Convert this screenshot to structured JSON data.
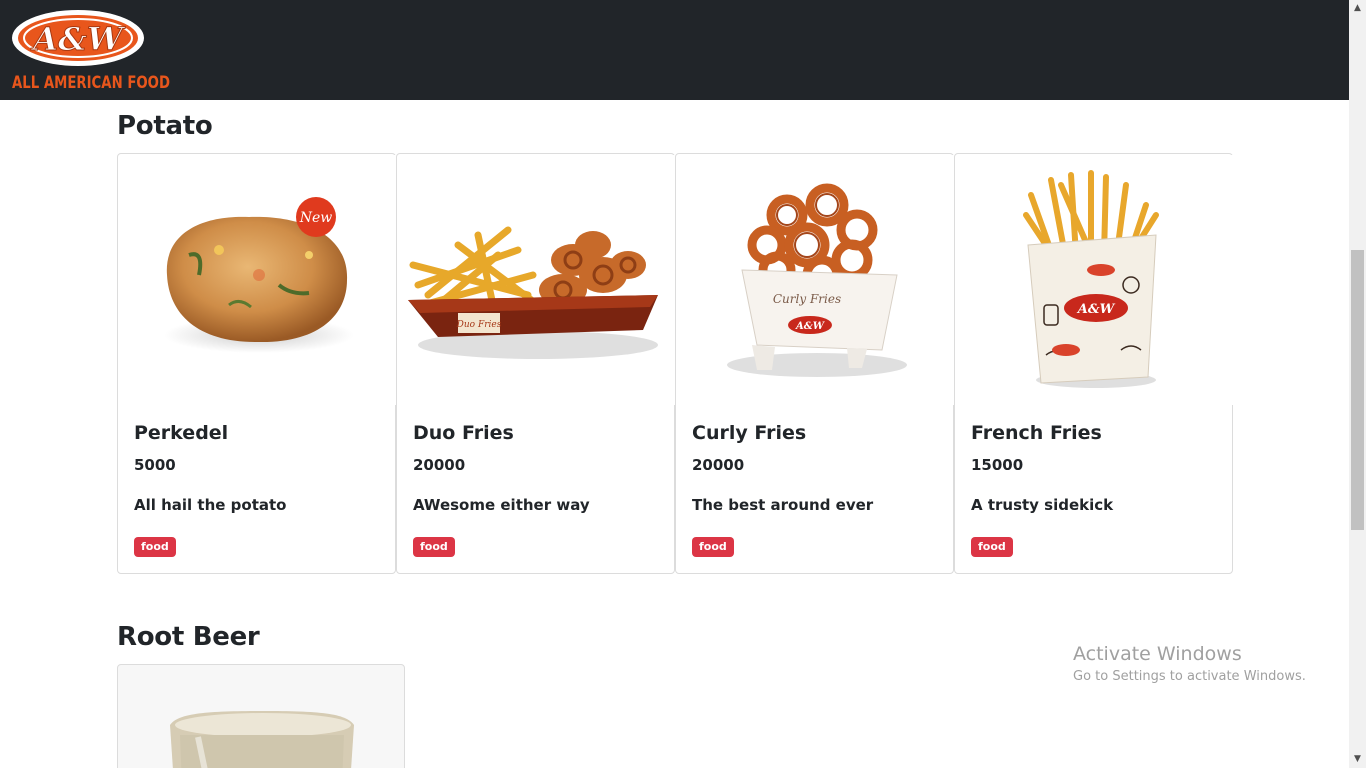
{
  "header": {
    "logo_text": "A&W",
    "logo_tagline": "ALL AMERICAN FOOD"
  },
  "sections": [
    {
      "title": "Potato",
      "items": [
        {
          "name": "Perkedel",
          "price": "5000",
          "description": "All hail the potato",
          "tag": "food",
          "image_badge": "New",
          "image": "perkedel"
        },
        {
          "name": "Duo Fries",
          "price": "20000",
          "description": "AWesome either way",
          "tag": "food",
          "image": "duo-fries",
          "box_text": "Duo Fries"
        },
        {
          "name": "Curly Fries",
          "price": "20000",
          "description": "The best around ever",
          "tag": "food",
          "image": "curly-fries",
          "box_text": "Curly Fries"
        },
        {
          "name": "French Fries",
          "price": "15000",
          "description": "A trusty sidekick",
          "tag": "food",
          "image": "french-fries"
        }
      ]
    },
    {
      "title": "Root Beer",
      "items": []
    }
  ],
  "watermark": {
    "title": "Activate Windows",
    "subtitle": "Go to Settings to activate Windows."
  },
  "colors": {
    "navbar": "#212529",
    "badge": "#dc3545",
    "brand_orange": "#e8561c"
  }
}
